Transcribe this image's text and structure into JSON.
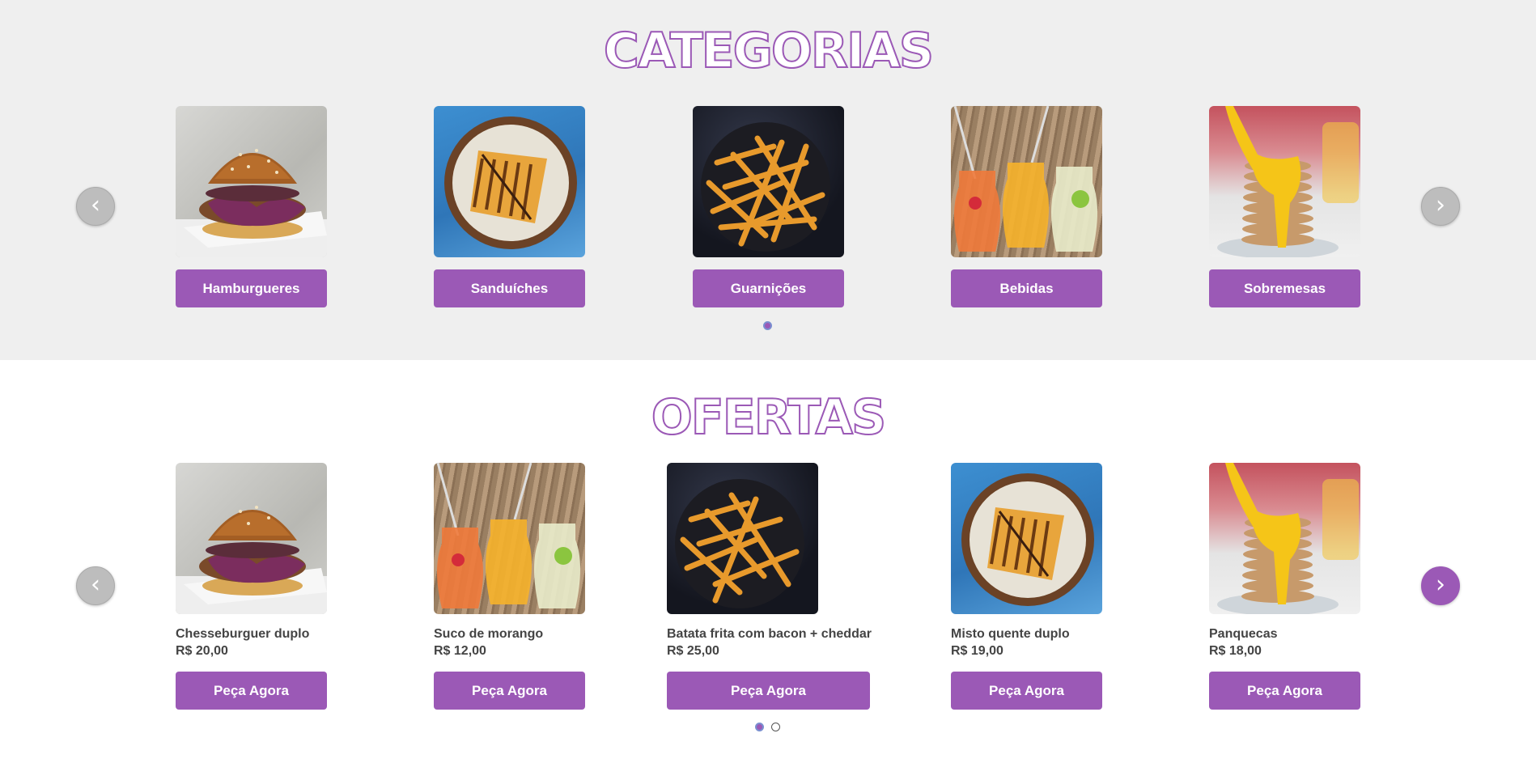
{
  "categories": {
    "title": "CATEGORIAS",
    "items": [
      {
        "label": "Hamburgueres",
        "image": "burger"
      },
      {
        "label": "Sanduíches",
        "image": "sandwich"
      },
      {
        "label": "Guarnições",
        "image": "fries"
      },
      {
        "label": "Bebidas",
        "image": "drinks"
      },
      {
        "label": "Sobremesas",
        "image": "pancakes"
      }
    ],
    "prev_icon": "‹",
    "next_icon": "›"
  },
  "offers": {
    "title": "OFERTAS",
    "items": [
      {
        "name": "Chesseburguer duplo",
        "price": "R$ 20,00",
        "button": "Peça Agora",
        "image": "burger"
      },
      {
        "name": "Suco de morango",
        "price": "R$ 12,00",
        "button": "Peça Agora",
        "image": "drinks"
      },
      {
        "name": "Batata frita com bacon + cheddar",
        "price": "R$ 25,00",
        "button": "Peça Agora",
        "image": "fries"
      },
      {
        "name": "Misto quente duplo",
        "price": "R$ 19,00",
        "button": "Peça Agora",
        "image": "sandwich"
      },
      {
        "name": "Panquecas",
        "price": "R$ 18,00",
        "button": "Peça Agora",
        "image": "pancakes"
      }
    ],
    "prev_icon": "‹",
    "next_icon": "›"
  },
  "colors": {
    "accent": "#9b59b6",
    "section_bg": "#efefef",
    "text": "#444444"
  }
}
